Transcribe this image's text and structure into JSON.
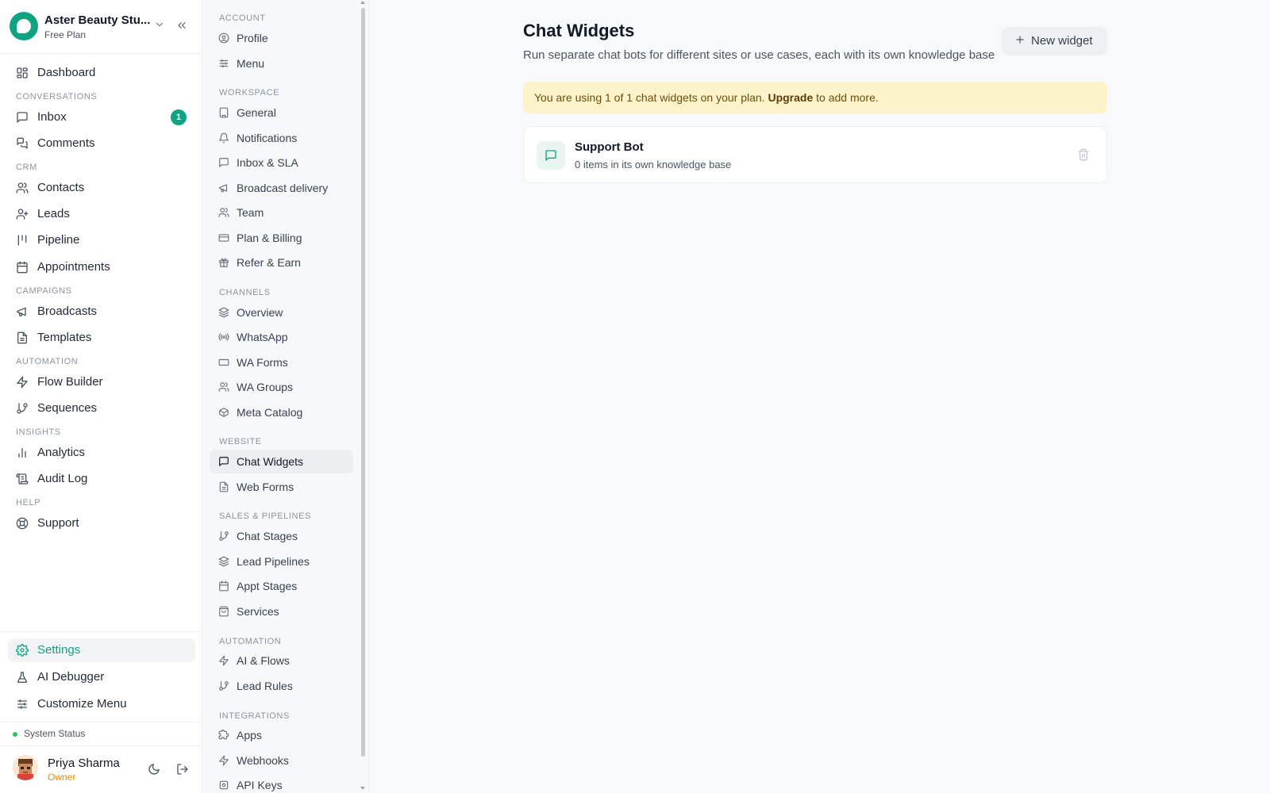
{
  "workspace": {
    "name": "Aster Beauty Stu...",
    "plan": "Free Plan"
  },
  "sidebar": {
    "top_items": [
      {
        "label": "Dashboard",
        "icon": "dashboard-icon"
      }
    ],
    "sections": [
      {
        "title": "CONVERSATIONS",
        "items": [
          {
            "label": "Inbox",
            "icon": "message-square-icon",
            "badge": "1"
          },
          {
            "label": "Comments",
            "icon": "messages-icon"
          }
        ]
      },
      {
        "title": "CRM",
        "items": [
          {
            "label": "Contacts",
            "icon": "users-icon"
          },
          {
            "label": "Leads",
            "icon": "user-plus-icon"
          },
          {
            "label": "Pipeline",
            "icon": "kanban-icon"
          },
          {
            "label": "Appointments",
            "icon": "calendar-icon"
          }
        ]
      },
      {
        "title": "CAMPAIGNS",
        "items": [
          {
            "label": "Broadcasts",
            "icon": "megaphone-icon"
          },
          {
            "label": "Templates",
            "icon": "file-text-icon"
          }
        ]
      },
      {
        "title": "AUTOMATION",
        "items": [
          {
            "label": "Flow Builder",
            "icon": "zap-icon"
          },
          {
            "label": "Sequences",
            "icon": "git-branch-icon"
          }
        ]
      },
      {
        "title": "INSIGHTS",
        "items": [
          {
            "label": "Analytics",
            "icon": "bar-chart-icon"
          },
          {
            "label": "Audit Log",
            "icon": "scroll-icon"
          }
        ]
      },
      {
        "title": "HELP",
        "items": [
          {
            "label": "Support",
            "icon": "life-buoy-icon"
          }
        ]
      }
    ],
    "bottom_items": [
      {
        "label": "Settings",
        "icon": "gear-icon",
        "active": true
      },
      {
        "label": "AI Debugger",
        "icon": "flask-icon"
      },
      {
        "label": "Customize Menu",
        "icon": "sliders-icon"
      }
    ],
    "system_status": "System Status",
    "user": {
      "name": "Priya Sharma",
      "role": "Owner"
    }
  },
  "settings_nav": {
    "sections": [
      {
        "title": "ACCOUNT",
        "items": [
          {
            "label": "Profile",
            "icon": "user-circle-icon"
          },
          {
            "label": "Menu",
            "icon": "sliders-icon"
          }
        ]
      },
      {
        "title": "WORKSPACE",
        "items": [
          {
            "label": "General",
            "icon": "building-icon"
          },
          {
            "label": "Notifications",
            "icon": "bell-icon"
          },
          {
            "label": "Inbox & SLA",
            "icon": "message-square-icon"
          },
          {
            "label": "Broadcast delivery",
            "icon": "megaphone-icon"
          },
          {
            "label": "Team",
            "icon": "users-icon"
          },
          {
            "label": "Plan & Billing",
            "icon": "credit-card-icon"
          },
          {
            "label": "Refer & Earn",
            "icon": "gift-icon"
          }
        ]
      },
      {
        "title": "CHANNELS",
        "items": [
          {
            "label": "Overview",
            "icon": "layers-icon"
          },
          {
            "label": "WhatsApp",
            "icon": "radio-icon"
          },
          {
            "label": "WA Forms",
            "icon": "rectangle-icon"
          },
          {
            "label": "WA Groups",
            "icon": "users-icon"
          },
          {
            "label": "Meta Catalog",
            "icon": "box-icon"
          }
        ]
      },
      {
        "title": "WEBSITE",
        "items": [
          {
            "label": "Chat Widgets",
            "icon": "message-square-icon",
            "active": true
          },
          {
            "label": "Web Forms",
            "icon": "file-text-icon"
          }
        ]
      },
      {
        "title": "SALES & PIPELINES",
        "items": [
          {
            "label": "Chat Stages",
            "icon": "git-branch-icon"
          },
          {
            "label": "Lead Pipelines",
            "icon": "layers-icon"
          },
          {
            "label": "Appt Stages",
            "icon": "calendar-icon"
          },
          {
            "label": "Services",
            "icon": "shopping-bag-icon"
          }
        ]
      },
      {
        "title": "AUTOMATION",
        "items": [
          {
            "label": "AI & Flows",
            "icon": "zap-icon"
          },
          {
            "label": "Lead Rules",
            "icon": "git-branch-icon"
          }
        ]
      },
      {
        "title": "INTEGRATIONS",
        "items": [
          {
            "label": "Apps",
            "icon": "puzzle-icon"
          },
          {
            "label": "Webhooks",
            "icon": "webhook-icon"
          },
          {
            "label": "API Keys",
            "icon": "key-icon"
          }
        ]
      }
    ]
  },
  "main": {
    "title": "Chat Widgets",
    "subtitle": "Run separate chat bots for different sites or use cases, each with its own knowledge base",
    "new_widget_label": "New widget",
    "banner": {
      "prefix": "You are using 1 of 1 chat widgets on your plan. ",
      "link": "Upgrade",
      "suffix": " to add more."
    },
    "widgets": [
      {
        "name": "Support Bot",
        "meta": "0 items in its own knowledge base"
      }
    ]
  },
  "colors": {
    "accent": "#10a37f",
    "banner_bg": "#fdf3cb",
    "owner_role": "#e8891c",
    "status_online": "#22c55e"
  }
}
